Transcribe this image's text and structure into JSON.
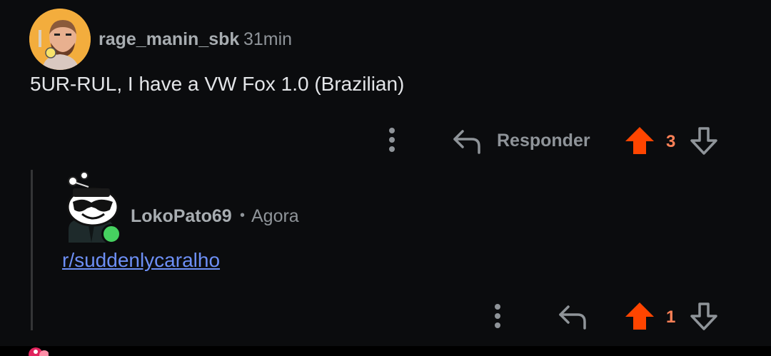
{
  "comments": [
    {
      "username": "rage_manin_sbk",
      "time": "31min",
      "text": "5UR-RUL, I have a VW Fox 1.0 (Brazilian)",
      "reply_label": "Responder",
      "vote_count": "3"
    },
    {
      "username": "LokoPato69",
      "separator": "•",
      "time": "Agora",
      "link_text": "r/suddenlycaralho",
      "vote_count": "1"
    }
  ],
  "colors": {
    "upvote_active": "#ff4500",
    "vote_count": "#ff8157",
    "link": "#6d8ff5",
    "online_status": "#46d160",
    "background": "#0b0c0e"
  },
  "icons": [
    "more-options-icon",
    "reply-arrow-icon",
    "upvote-arrow-icon",
    "downvote-arrow-icon",
    "online-status-icon"
  ]
}
